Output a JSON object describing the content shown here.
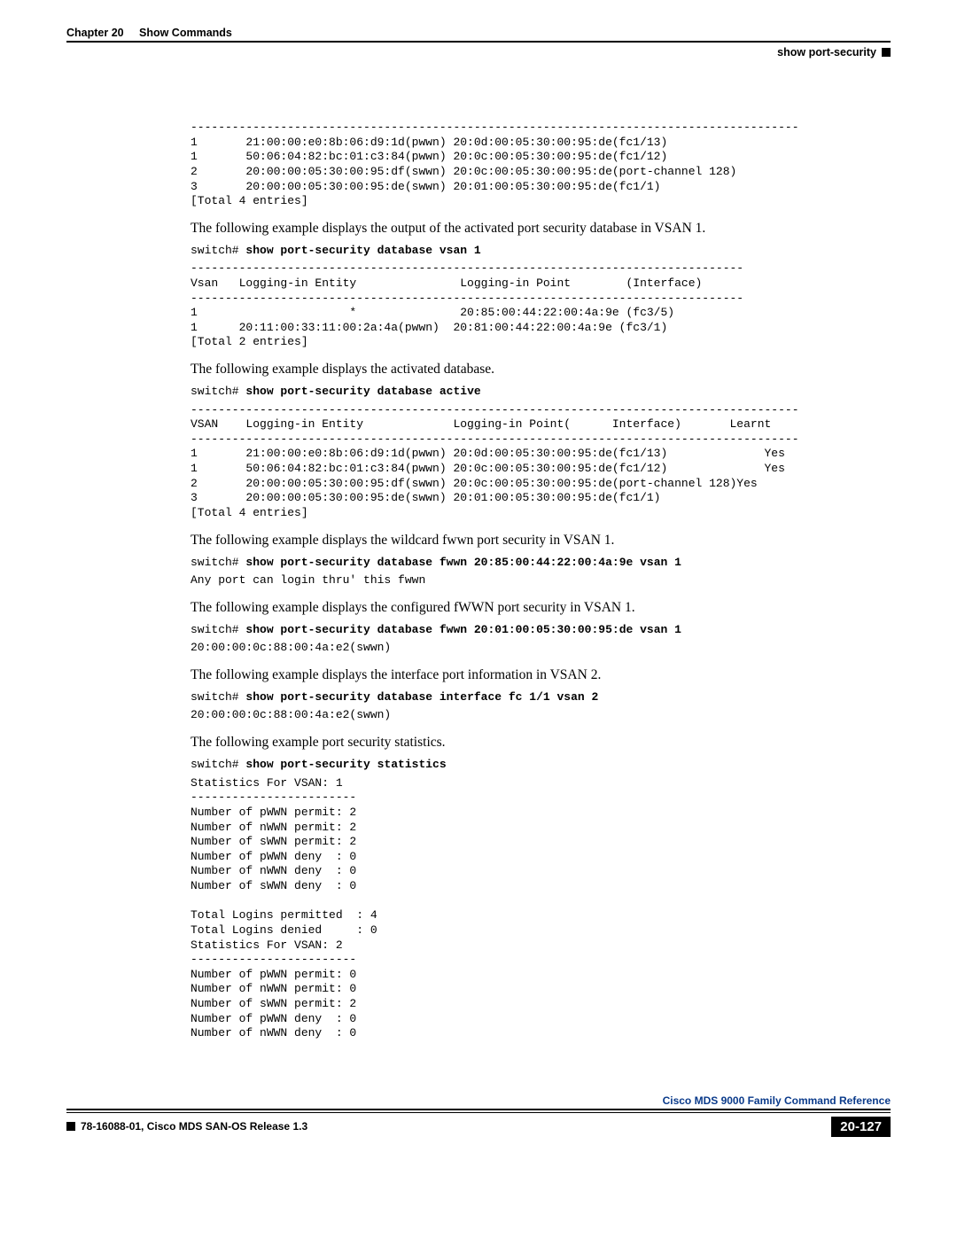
{
  "header": {
    "chapter": "Chapter 20",
    "title": "Show Commands",
    "section": "show port-security"
  },
  "block0": "----------------------------------------------------------------------------------------\n1       21:00:00:e0:8b:06:d9:1d(pwwn) 20:0d:00:05:30:00:95:de(fc1/13)\n1       50:06:04:82:bc:01:c3:84(pwwn) 20:0c:00:05:30:00:95:de(fc1/12)\n2       20:00:00:05:30:00:95:df(swwn) 20:0c:00:05:30:00:95:de(port-channel 128)\n3       20:00:00:05:30:00:95:de(swwn) 20:01:00:05:30:00:95:de(fc1/1)\n[Total 4 entries]",
  "para1": "The following example displays the output of the activated port security database in VSAN 1.",
  "cmd1_prompt": "switch# ",
  "cmd1_bold": "show port-security database vsan 1",
  "block1": "--------------------------------------------------------------------------------\nVsan   Logging-in Entity               Logging-in Point        (Interface)\n--------------------------------------------------------------------------------\n1                      *               20:85:00:44:22:00:4a:9e (fc3/5)\n1      20:11:00:33:11:00:2a:4a(pwwn)  20:81:00:44:22:00:4a:9e (fc3/1)\n[Total 2 entries]",
  "para2": "The following example displays the activated database.",
  "cmd2_prompt": "switch# ",
  "cmd2_bold": "show port-security database active",
  "block2": "----------------------------------------------------------------------------------------\nVSAN    Logging-in Entity             Logging-in Point(      Interface)       Learnt\n----------------------------------------------------------------------------------------\n1       21:00:00:e0:8b:06:d9:1d(pwwn) 20:0d:00:05:30:00:95:de(fc1/13)              Yes\n1       50:06:04:82:bc:01:c3:84(pwwn) 20:0c:00:05:30:00:95:de(fc1/12)              Yes\n2       20:00:00:05:30:00:95:df(swwn) 20:0c:00:05:30:00:95:de(port-channel 128)Yes\n3       20:00:00:05:30:00:95:de(swwn) 20:01:00:05:30:00:95:de(fc1/1)\n[Total 4 entries]",
  "para3": "The following example displays the wildcard fwwn port security in VSAN 1.",
  "cmd3_prompt": "switch# ",
  "cmd3_bold": "show port-security database fwwn 20:85:00:44:22:00:4a:9e vsan 1",
  "block3": "Any port can login thru' this fwwn",
  "para4": "The following example displays the configured fWWN port security in VSAN 1.",
  "cmd4_prompt": "switch# ",
  "cmd4_bold": "show port-security database fwwn 20:01:00:05:30:00:95:de vsan 1",
  "block4": "20:00:00:0c:88:00:4a:e2(swwn)",
  "para5": "The following example displays the interface port information in VSAN 2.",
  "cmd5_prompt": "switch# ",
  "cmd5_bold": "show port-security database interface fc 1/1 vsan 2",
  "block5": "20:00:00:0c:88:00:4a:e2(swwn)",
  "para6": "The following example port security statistics.",
  "cmd6_prompt": "switch# ",
  "cmd6_bold": "show port-security statistics",
  "block6": "Statistics For VSAN: 1\n------------------------\nNumber of pWWN permit: 2\nNumber of nWWN permit: 2\nNumber of sWWN permit: 2\nNumber of pWWN deny  : 0\nNumber of nWWN deny  : 0\nNumber of sWWN deny  : 0\n\nTotal Logins permitted  : 4\nTotal Logins denied     : 0\nStatistics For VSAN: 2\n------------------------\nNumber of pWWN permit: 0\nNumber of nWWN permit: 0\nNumber of sWWN permit: 2\nNumber of pWWN deny  : 0\nNumber of nWWN deny  : 0",
  "footer": {
    "booktitle": "Cisco MDS 9000 Family Command Reference",
    "docid": "78-16088-01, Cisco MDS SAN-OS Release 1.3",
    "pagenum": "20-127"
  }
}
